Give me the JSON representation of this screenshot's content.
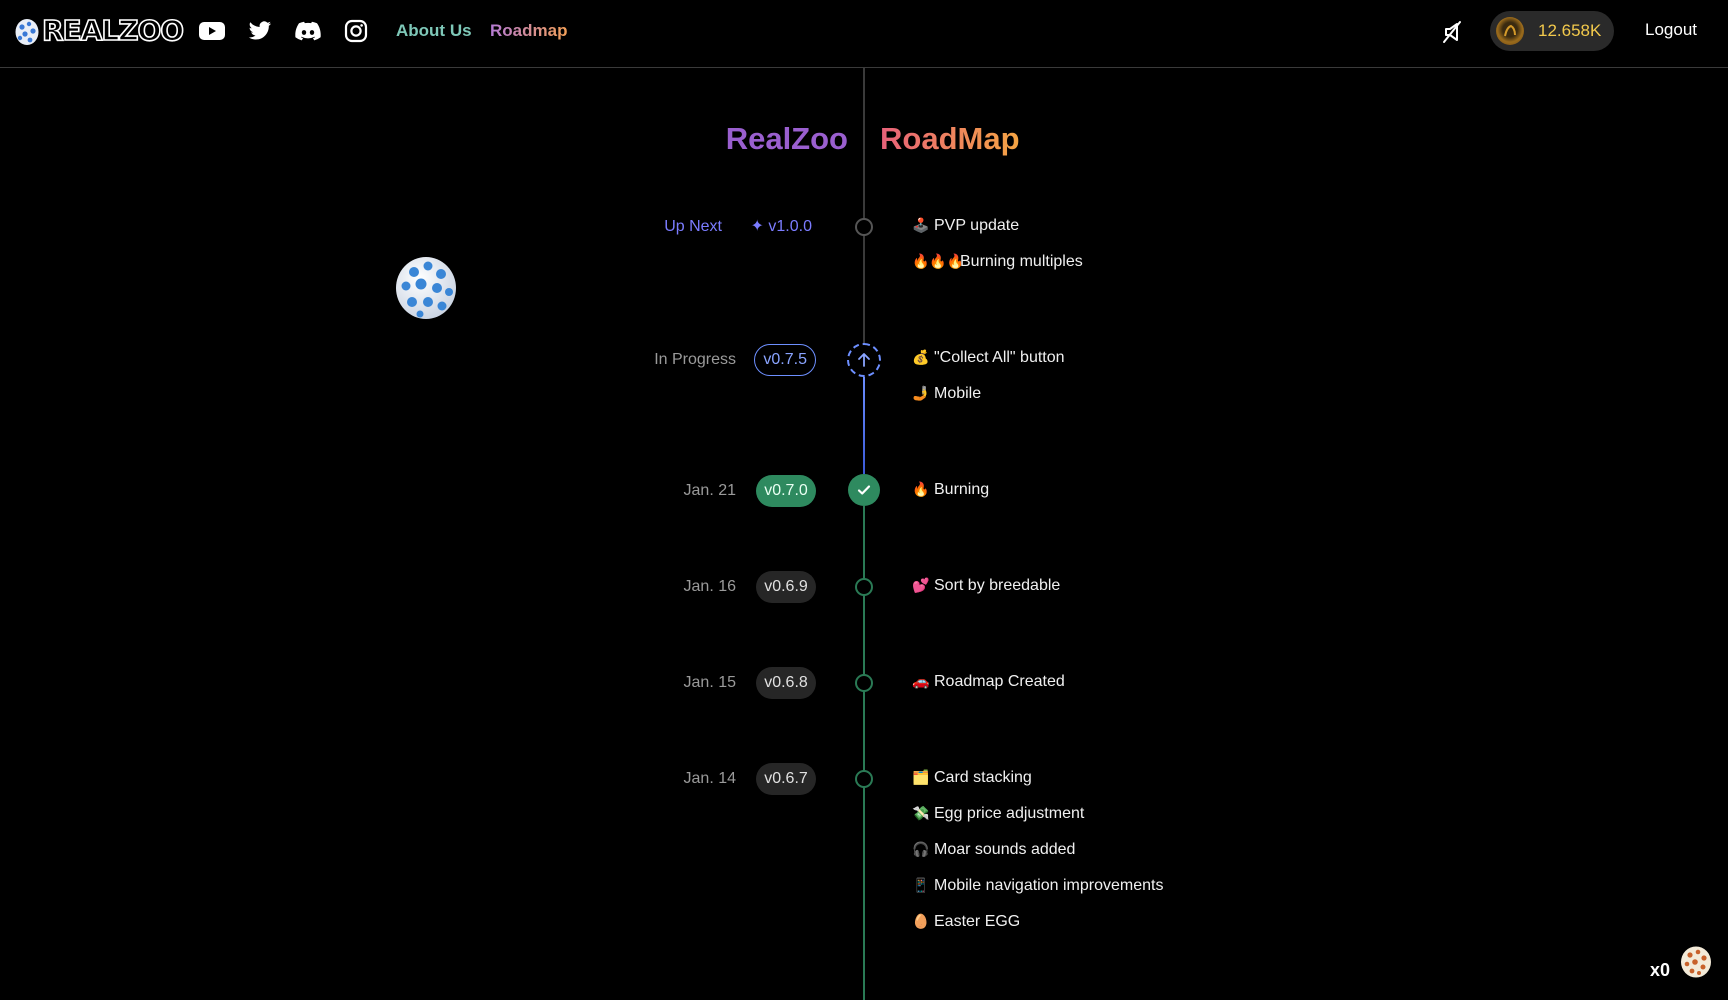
{
  "header": {
    "logo_text": "REALZOO",
    "social": [
      {
        "name": "youtube-icon"
      },
      {
        "name": "twitter-icon"
      },
      {
        "name": "discord-icon"
      },
      {
        "name": "instagram-icon"
      }
    ],
    "nav": {
      "about": "About Us",
      "roadmap": "Roadmap"
    },
    "balance": "12.658K",
    "logout": "Logout"
  },
  "roadmap": {
    "title_left": "RealZoo",
    "title_right": "RoadMap",
    "releases": [
      {
        "label": "Up Next",
        "version": "v1.0.0",
        "status": "next",
        "items": [
          {
            "emoji": "🕹️",
            "text": "PVP update"
          },
          {
            "emoji": "🔥🔥🔥",
            "text": "Burning multiples"
          }
        ]
      },
      {
        "label": "In Progress",
        "version": "v0.7.5",
        "status": "progress",
        "items": [
          {
            "emoji": "💰",
            "text": "\"Collect All\" button"
          },
          {
            "emoji": "🤳",
            "text": "Mobile"
          }
        ]
      },
      {
        "label": "Jan. 21",
        "version": "v0.7.0",
        "status": "done",
        "items": [
          {
            "emoji": "🔥",
            "text": "Burning"
          }
        ]
      },
      {
        "label": "Jan. 16",
        "version": "v0.6.9",
        "status": "released",
        "items": [
          {
            "emoji": "💕",
            "text": "Sort by breedable"
          }
        ]
      },
      {
        "label": "Jan. 15",
        "version": "v0.6.8",
        "status": "released",
        "items": [
          {
            "emoji": "🚗",
            "text": "Roadmap Created"
          }
        ]
      },
      {
        "label": "Jan. 14",
        "version": "v0.6.7",
        "status": "released",
        "items": [
          {
            "emoji": "🗂️",
            "text": "Card stacking"
          },
          {
            "emoji": "💸",
            "text": "Egg price adjustment"
          },
          {
            "emoji": "🎧",
            "text": "Moar sounds added"
          },
          {
            "emoji": "📱",
            "text": "Mobile navigation improvements"
          },
          {
            "emoji": "🥚",
            "text": "Easter EGG"
          }
        ]
      }
    ]
  },
  "egg_counter": "x0",
  "colors": {
    "accent_green": "#2e8a5f",
    "accent_blue": "#6d8fff",
    "balance_gold": "#f2c94c"
  }
}
